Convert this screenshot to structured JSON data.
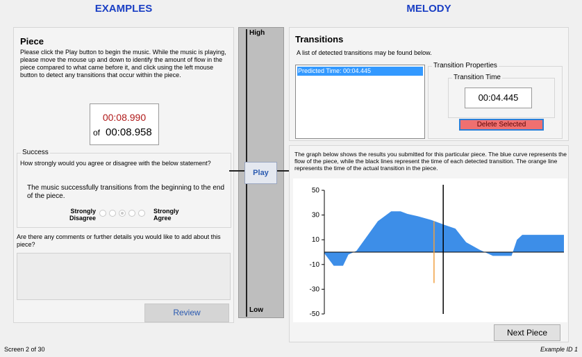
{
  "examples_title": "EXAMPLES",
  "melody_title": "MELODY",
  "piece": {
    "title": "Piece",
    "instructions": "Please click the Play button to begin the music. While the music is playing, please move the mouse up and down to identify the amount of flow in the piece compared to what came before it, and click using the left mouse button to detect any transitions that occur within the piece.",
    "current_time": "00:08.990",
    "of_label": "of",
    "total_time": "00:08.958"
  },
  "success": {
    "legend": "Success",
    "question": "How strongly would you agree or disagree with the below statement?",
    "statement": "The music successfully transitions from the beginning to the end of the piece.",
    "scale_left": "Strongly Disagree",
    "scale_right": "Strongly Agree",
    "selected_index": 2,
    "option_count": 5
  },
  "comments": {
    "question": "Are there any comments or further details you would like to add about this piece?",
    "value": ""
  },
  "review_label": "Review",
  "slider": {
    "high_label": "High",
    "low_label": "Low",
    "play_label": "Play"
  },
  "transitions": {
    "title": "Transitions",
    "description": "A list of detected transitions may be found below.",
    "items": [
      "Predicted Time: 00:04.445"
    ],
    "properties_legend": "Transition Properties",
    "time_legend": "Transition Time",
    "time_value": "00:04.445",
    "delete_label": "Delete Selected"
  },
  "graph": {
    "description": "The graph below shows the results you submitted for this particular piece. The blue curve represents the flow of the piece, while the black lines represent the time of each detected transition. The orange line represents the time of the actual transition in the piece."
  },
  "chart_data": {
    "type": "area",
    "ylim": [
      -50,
      50
    ],
    "yticks": [
      50,
      30,
      10,
      -10,
      -30,
      -50
    ],
    "xlim": [
      0,
      8.958
    ],
    "grid": false,
    "series": [
      {
        "color": "#3d8ee8",
        "x": [
          0,
          0.35,
          0.7,
          0.9,
          1.2,
          1.5,
          2.0,
          2.5,
          2.85,
          3.1,
          3.5,
          4.0,
          4.5,
          4.9,
          5.3,
          5.8,
          6.3,
          6.7,
          7.0,
          7.2,
          7.4,
          8.958
        ],
        "y": [
          -1,
          -11,
          -11,
          -2,
          1,
          10,
          25,
          33,
          33,
          31,
          29,
          26,
          22,
          19,
          8,
          2,
          -3,
          -3,
          -3,
          10,
          14,
          14
        ]
      }
    ],
    "transition_lines": [
      4.445
    ],
    "actual_transition": {
      "x": 4.1,
      "y_range": [
        -25,
        25
      ],
      "color": "#f0a040"
    }
  },
  "next_label": "Next Piece",
  "status": {
    "left": "Screen 2 of 30",
    "right": "Example ID 1"
  },
  "colors": {
    "title": "#1a3fc4",
    "selected": "#3399ff",
    "delete": "#f07070",
    "curve": "#3d8ee8"
  }
}
